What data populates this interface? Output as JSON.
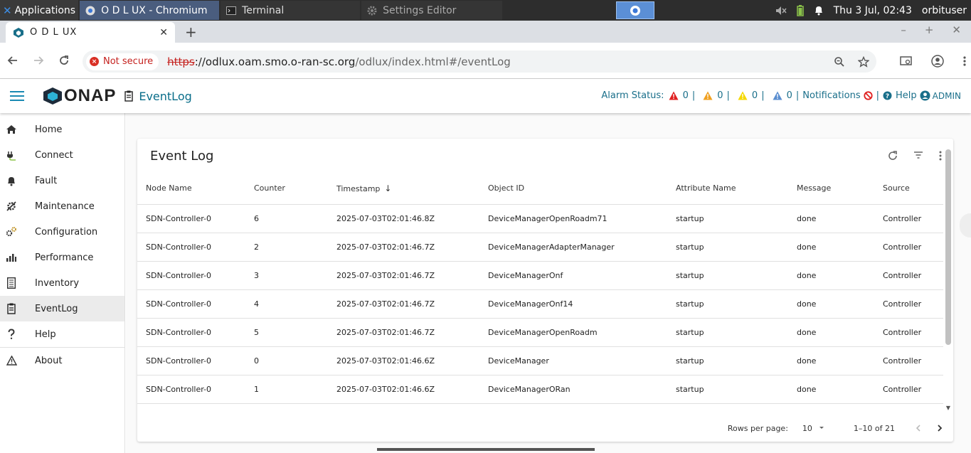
{
  "taskbar": {
    "apps_label": "Applications",
    "tasks": [
      {
        "label": "O D L UX - Chromium"
      },
      {
        "label": "Terminal"
      },
      {
        "label": "Settings Editor"
      }
    ],
    "clock": "Thu  3 Jul, 02:43",
    "user": "orbituser"
  },
  "browser": {
    "tab_title": "O D L UX",
    "new_tab": "+",
    "security_label": "Not secure",
    "url_scheme": "https",
    "url_host": "://odlux.oam.smo.o-ran-sc.org",
    "url_path": "/odlux/index.html#/eventLog"
  },
  "header": {
    "logo_text": "ONAP",
    "page_title": "EventLog",
    "alarm_status_label": "Alarm Status:",
    "alarm_counts": [
      "0",
      "0",
      "0",
      "0"
    ],
    "notifications_label": "Notifications",
    "help_label": "Help",
    "user_label": "ADMIN",
    "colors": {
      "critical": "#e02020",
      "major": "#f0a020",
      "minor": "#f5d800",
      "warning": "#5a8ed0",
      "accent": "#1a6f8a"
    }
  },
  "sidebar": {
    "items": [
      {
        "label": "Home",
        "icon": "home-icon"
      },
      {
        "label": "Connect",
        "icon": "plug-icon"
      },
      {
        "label": "Fault",
        "icon": "bell-icon"
      },
      {
        "label": "Maintenance",
        "icon": "wrench-icon"
      },
      {
        "label": "Configuration",
        "icon": "gears-icon"
      },
      {
        "label": "Performance",
        "icon": "bar-chart-icon"
      },
      {
        "label": "Inventory",
        "icon": "list-icon"
      },
      {
        "label": "EventLog",
        "icon": "clipboard-icon"
      },
      {
        "label": "Help",
        "icon": "question-icon"
      },
      {
        "label": "About",
        "icon": "warning-icon"
      }
    ]
  },
  "eventlog": {
    "title": "Event Log",
    "columns": [
      "Node Name",
      "Counter",
      "Timestamp",
      "Object ID",
      "Attribute Name",
      "Message",
      "Source"
    ],
    "rows": [
      [
        "SDN-Controller-0",
        "6",
        "2025-07-03T02:01:46.8Z",
        "DeviceManagerOpenRoadm71",
        "startup",
        "done",
        "Controller"
      ],
      [
        "SDN-Controller-0",
        "2",
        "2025-07-03T02:01:46.7Z",
        "DeviceManagerAdapterManager",
        "startup",
        "done",
        "Controller"
      ],
      [
        "SDN-Controller-0",
        "3",
        "2025-07-03T02:01:46.7Z",
        "DeviceManagerOnf",
        "startup",
        "done",
        "Controller"
      ],
      [
        "SDN-Controller-0",
        "4",
        "2025-07-03T02:01:46.7Z",
        "DeviceManagerOnf14",
        "startup",
        "done",
        "Controller"
      ],
      [
        "SDN-Controller-0",
        "5",
        "2025-07-03T02:01:46.7Z",
        "DeviceManagerOpenRoadm",
        "startup",
        "done",
        "Controller"
      ],
      [
        "SDN-Controller-0",
        "0",
        "2025-07-03T02:01:46.6Z",
        "DeviceManager",
        "startup",
        "done",
        "Controller"
      ],
      [
        "SDN-Controller-0",
        "1",
        "2025-07-03T02:01:46.6Z",
        "DeviceManagerORan",
        "startup",
        "done",
        "Controller"
      ]
    ],
    "pagination": {
      "rows_per_page_label": "Rows per page:",
      "rows_per_page_value": "10",
      "range_label": "1–10 of 21"
    }
  }
}
